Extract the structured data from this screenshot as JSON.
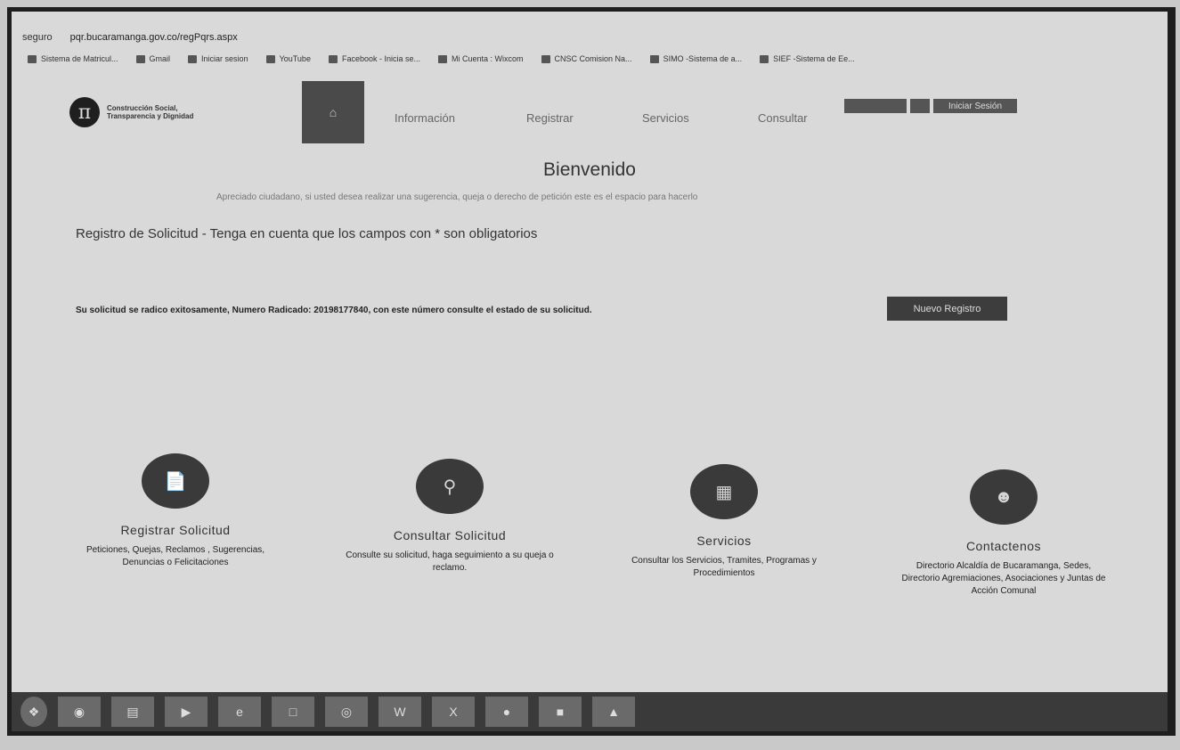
{
  "browser": {
    "security_label": "seguro",
    "url": "pqr.bucaramanga.gov.co/regPqrs.aspx",
    "bookmarks": [
      {
        "label": "Sistema de Matricul..."
      },
      {
        "label": "Gmail"
      },
      {
        "label": "Iniciar sesion"
      },
      {
        "label": "YouTube"
      },
      {
        "label": "Facebook - Inicia se..."
      },
      {
        "label": "Mi Cuenta : Wixcom"
      },
      {
        "label": "CNSC Comision Na..."
      },
      {
        "label": "SIMO -Sistema de a..."
      },
      {
        "label": "SIEF -Sistema de Ee..."
      }
    ]
  },
  "header": {
    "logo_glyph": "π",
    "logo_text_line1": "Construcción Social,",
    "logo_text_line2": "Transparencia y Dignidad",
    "home_icon": "home-icon",
    "nav": [
      "Información",
      "Registrar",
      "Servicios",
      "Consultar"
    ],
    "top_buttons": [
      "",
      "",
      "Iniciar Sesión"
    ]
  },
  "main": {
    "welcome": "Bienvenido",
    "welcome_sub": "Apreciado ciudadano, si usted desea realizar una sugerencia, queja o derecho de petición este es el espacio para hacerlo",
    "register_heading": "Registro de Solicitud - Tenga en cuenta que los campos con * son obligatorios",
    "success_message": "Su solicitud se radico exitosamente, Numero Radicado: 20198177840, con este número consulte el estado de su solicitud.",
    "new_button": "Nuevo Registro"
  },
  "features": [
    {
      "icon": "document-icon",
      "title": "Registrar Solicitud",
      "desc": "Peticiones, Quejas, Reclamos , Sugerencias, Denuncias o Felicitaciones"
    },
    {
      "icon": "search-icon",
      "title": "Consultar Solicitud",
      "desc": "Consulte su solicitud, haga seguimiento a su queja o reclamo."
    },
    {
      "icon": "services-icon",
      "title": "Servicios",
      "desc": "Consultar los Servicios, Tramites, Programas y Procedimientos"
    },
    {
      "icon": "contact-icon",
      "title": "Contactenos",
      "desc": "Directorio Alcaldía de Bucaramanga, Sedes, Directorio Agremiaciones, Asociaciones y Juntas de Acción Comunal"
    }
  ],
  "taskbar": {
    "items": [
      "start-icon",
      "firefox-icon",
      "files-icon",
      "media-icon",
      "ie-icon",
      "explorer-icon",
      "chrome-icon",
      "word-icon",
      "excel-icon",
      "app-icon",
      "app2-icon",
      "app3-icon"
    ]
  }
}
